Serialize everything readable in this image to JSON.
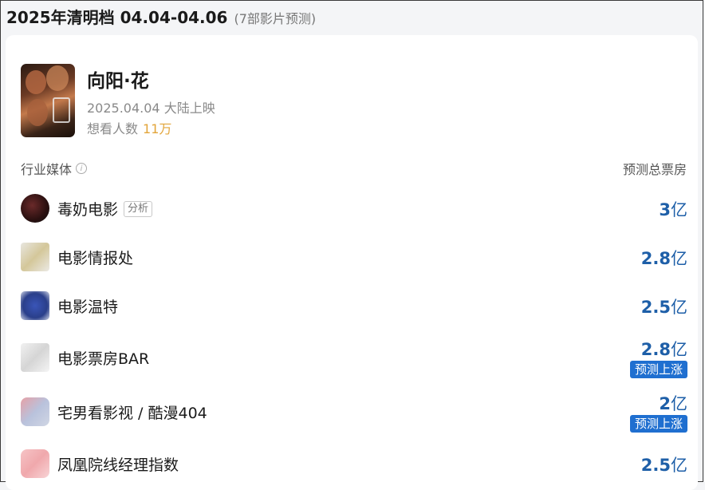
{
  "header": {
    "title": "2025年清明档 04.04-04.06",
    "subtitle": "(7部影片预测)"
  },
  "movie": {
    "title": "向阳·花",
    "date_region": "2025.04.04 大陆上映",
    "want_label": "想看人数",
    "want_count": "11万"
  },
  "table": {
    "left_header": "行业媒体",
    "right_header": "预测总票房",
    "rows": [
      {
        "name": "毒奶电影",
        "tag": "分析",
        "value": "3",
        "unit": "亿",
        "badge": ""
      },
      {
        "name": "电影情报处",
        "tag": "",
        "value": "2.8",
        "unit": "亿",
        "badge": ""
      },
      {
        "name": "电影温特",
        "tag": "",
        "value": "2.5",
        "unit": "亿",
        "badge": ""
      },
      {
        "name": "电影票房BAR",
        "tag": "",
        "value": "2.8",
        "unit": "亿",
        "badge": "预测上涨"
      },
      {
        "name": "宅男看影视 / 酷漫404",
        "tag": "",
        "value": "2",
        "unit": "亿",
        "badge": "预测上涨"
      },
      {
        "name": "凤凰院线经理指数",
        "tag": "",
        "value": "2.5",
        "unit": "亿",
        "badge": ""
      }
    ]
  },
  "colors": {
    "accent_blue": "#1e5fa8",
    "badge_blue": "#1f6fd0",
    "want_count_gold": "#e2a53a"
  },
  "icons": {
    "info": "info-circle-icon"
  }
}
